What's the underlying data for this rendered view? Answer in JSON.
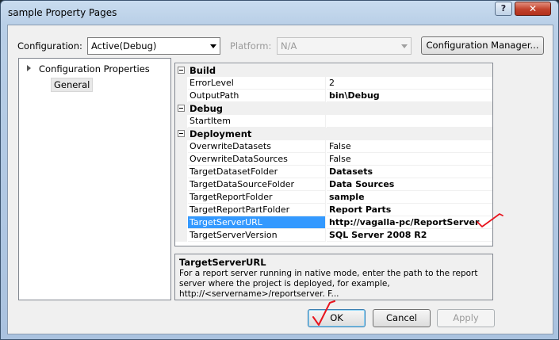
{
  "window": {
    "title": "sample Property Pages",
    "help_label": "?",
    "close_label": "✕"
  },
  "config_bar": {
    "configuration_label": "Configuration:",
    "configuration_value": "Active(Debug)",
    "platform_label": "Platform:",
    "platform_value": "N/A",
    "manager_button": "Configuration Manager..."
  },
  "tree": {
    "root": "Configuration Properties",
    "child": "General"
  },
  "property_grid": {
    "build": {
      "category": "Build",
      "error_level": {
        "name": "ErrorLevel",
        "value": "2"
      },
      "output_path": {
        "name": "OutputPath",
        "value": "bin\\Debug"
      }
    },
    "debug": {
      "category": "Debug",
      "start_item": {
        "name": "StartItem",
        "value": ""
      }
    },
    "deployment": {
      "category": "Deployment",
      "overwrite_datasets": {
        "name": "OverwriteDatasets",
        "value": "False"
      },
      "overwrite_datasources": {
        "name": "OverwriteDataSources",
        "value": "False"
      },
      "target_dataset_folder": {
        "name": "TargetDatasetFolder",
        "value": "Datasets"
      },
      "target_datasource_folder": {
        "name": "TargetDataSourceFolder",
        "value": "Data Sources"
      },
      "target_report_folder": {
        "name": "TargetReportFolder",
        "value": "sample"
      },
      "target_reportpart_folder": {
        "name": "TargetReportPartFolder",
        "value": "Report Parts"
      },
      "target_server_url": {
        "name": "TargetServerURL",
        "value": "http://vagalla-pc/ReportServer"
      },
      "target_server_version": {
        "name": "TargetServerVersion",
        "value": "SQL Server 2008 R2"
      }
    }
  },
  "description": {
    "title": "TargetServerURL",
    "text": "For a report server running in native mode, enter the path to the report server where the project is deployed, for example, http://<servername>/reportserver. F..."
  },
  "buttons": {
    "ok": "OK",
    "cancel": "Cancel",
    "apply": "Apply"
  },
  "colors": {
    "selection": "#3399ff",
    "annotation_red": "#e8141e"
  }
}
